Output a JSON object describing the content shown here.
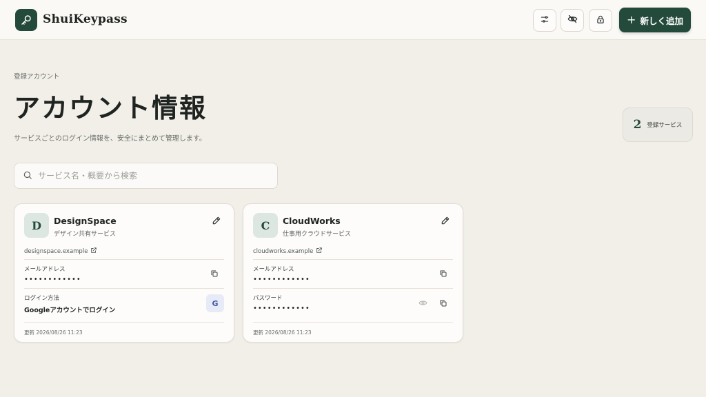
{
  "app": {
    "name": "ShuiKeypass",
    "add_button_label": "新しく追加"
  },
  "page": {
    "eyebrow": "登録アカウント",
    "title": "アカウント情報",
    "subtitle": "サービスごとのログイン情報を、安全にまとめて管理します。",
    "stat_count": "2",
    "stat_label": "登録サービス"
  },
  "search": {
    "placeholder": "サービス名・概要から検索",
    "value": ""
  },
  "cards": [
    {
      "initial": "D",
      "name": "DesignSpace",
      "description": "デザイン共有サービス",
      "url": "designspace.example",
      "field1_label": "メールアドレス",
      "field1_value": "••••••••••••",
      "field2_label": "ログイン方法",
      "field2_value": "Googleアカウントでログイン",
      "google_badge": "G",
      "updated": "更新 2026/08/26 11:23"
    },
    {
      "initial": "C",
      "name": "CloudWorks",
      "description": "仕事用クラウドサービス",
      "url": "cloudworks.example",
      "field1_label": "メールアドレス",
      "field1_value": "••••••••••••",
      "field2_label": "パスワード",
      "field2_value": "••••••••••••",
      "updated": "更新 2026/08/26 11:23"
    }
  ],
  "colors": {
    "brand": "#244a3c",
    "background": "#f2efe9",
    "card": "#fdfcfa"
  },
  "icons": {
    "logo": "key-icon",
    "filter": "sliders-icon",
    "hide": "eye-off-icon",
    "lock": "lock-icon",
    "search": "search-icon",
    "edit": "pencil-icon",
    "external": "external-link-icon",
    "copy": "copy-icon",
    "reveal": "eye-icon"
  }
}
